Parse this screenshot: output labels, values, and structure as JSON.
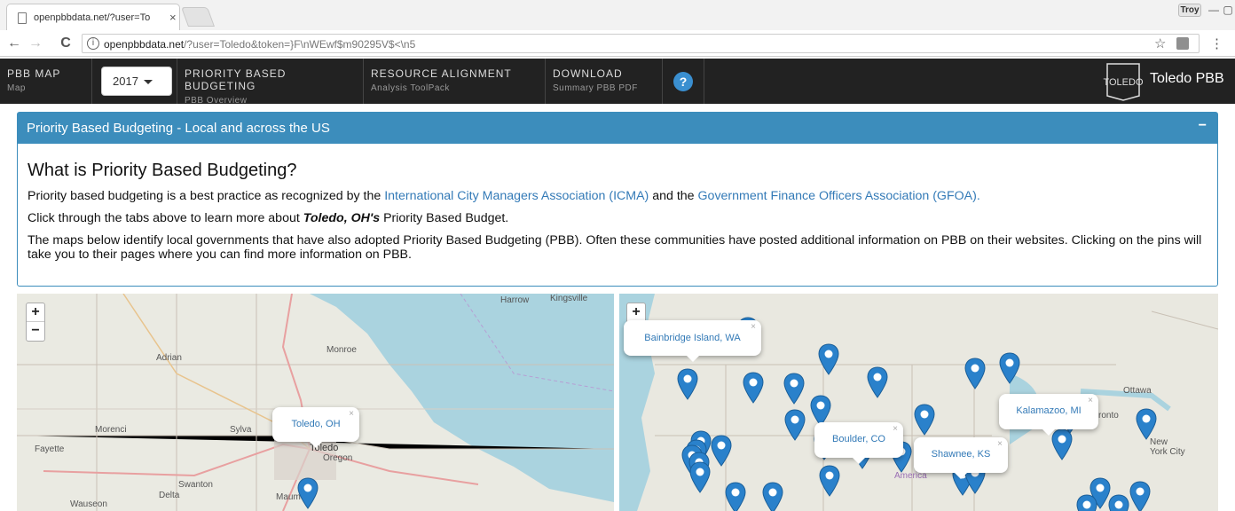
{
  "browser": {
    "tab_title": "openpbbdata.net/?user=To",
    "tab_close": "×",
    "user_badge": "Troy",
    "win_min": "—",
    "win_max": "▢",
    "win_close": "✕",
    "url_host": "openpbbdata.net",
    "url_path": "/?user=Toledo&token=}F\\nWEwf$m90295V$<\\n5",
    "back": "←",
    "forward": "→",
    "reload": "C",
    "info_icon": "i",
    "star": "☆",
    "menu": "⋮"
  },
  "navbar": {
    "items": [
      {
        "main": "PBB MAP",
        "sub": "Map"
      },
      {
        "main": "PRIORITY BASED BUDGETING",
        "sub": "PBB Overview"
      },
      {
        "main": "RESOURCE ALIGNMENT",
        "sub": "Analysis ToolPack"
      },
      {
        "main": "DOWNLOAD",
        "sub": "Summary PBB PDF"
      }
    ],
    "year": "2017",
    "help": "?",
    "brand": "Toledo PBB",
    "logo_text": "TOLEDO"
  },
  "panel": {
    "title": "Priority Based Budgeting - Local and across the US",
    "collapse": "−",
    "heading": "What is Priority Based Budgeting?",
    "p1_pre": "Priority based budgeting is a best practice as recognized by the ",
    "p1_link1": "International City Managers Association (ICMA)",
    "p1_mid": " and the ",
    "p1_link2": "Government Finance Officers Association (GFOA).",
    "p2_pre": "Click through the tabs above to learn more about ",
    "p2_em": "Toledo, OH's",
    "p2_post": " Priority Based Budget.",
    "p3": "The maps below identify local governments that have also adopted Priority Based Budgeting (PBB). Often these communities have posted additional information on PBB on their websites. Clicking on the pins will take you to their pages where you can find more information on PBB."
  },
  "map_local": {
    "zoom_in": "+",
    "zoom_out": "−",
    "popup": "Toledo, OH",
    "popup_close": "×",
    "labels": [
      "Harrow",
      "Kingsville",
      "Adrian",
      "Monroe",
      "Morenci",
      "Sylva",
      "Toledo",
      "Oregon",
      "Fayette",
      "Swanton",
      "Delta",
      "Maumee",
      "Wauseon"
    ]
  },
  "map_us": {
    "zoom_in": "+",
    "zoom_out": "−",
    "popups": [
      "Bainbridge Island, WA",
      "Kalamazoo, MI",
      "Boulder, CO",
      "Shawnee, KS"
    ],
    "popup_close": "×",
    "labels": [
      "Ottawa",
      "ronto",
      "New York City",
      "America"
    ]
  },
  "colors": {
    "navbar": "#222222",
    "panel_accent": "#3c8dbc",
    "link": "#337ab7",
    "pin": "#2a81cb",
    "help_icon": "#3a8fd0"
  }
}
